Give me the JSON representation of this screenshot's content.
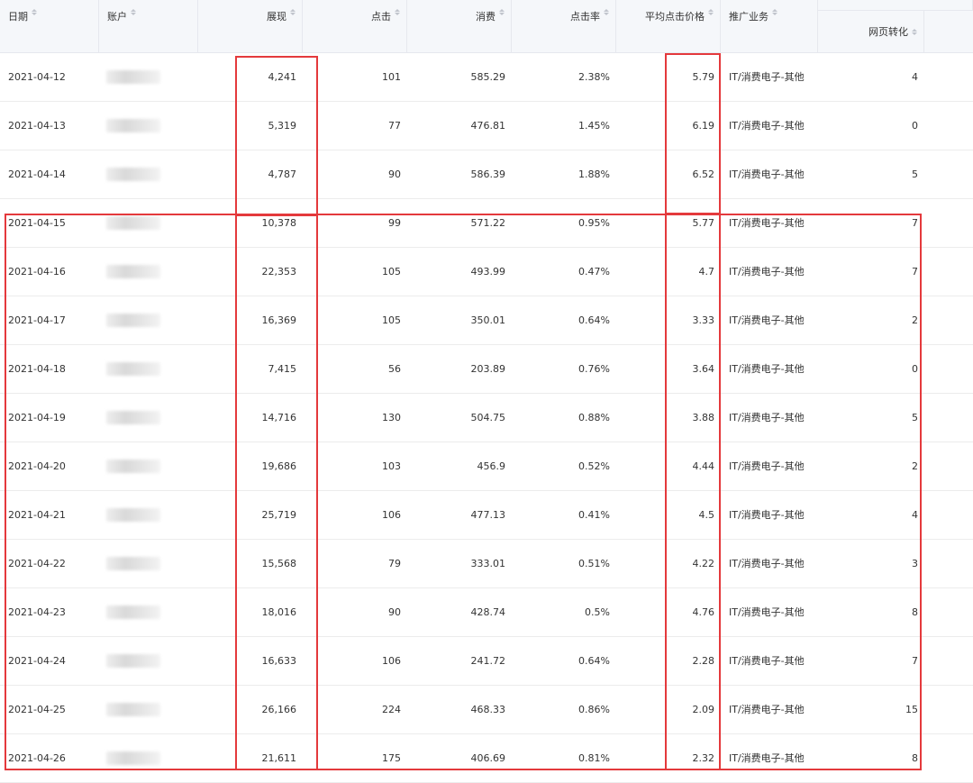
{
  "table": {
    "columns": {
      "date": "日期",
      "account": "账户",
      "impressions": "展现",
      "clicks": "点击",
      "cost": "消费",
      "ctr": "点击率",
      "avg_cpc": "平均点击价格",
      "business": "推广业务",
      "web_conversion": "网页转化"
    },
    "rows": [
      {
        "date": "2021-04-12",
        "impressions": "4,241",
        "clicks": "101",
        "cost": "585.29",
        "ctr": "2.38%",
        "avg_cpc": "5.79",
        "business": "IT/消费电子-其他",
        "web_conversion": "4"
      },
      {
        "date": "2021-04-13",
        "impressions": "5,319",
        "clicks": "77",
        "cost": "476.81",
        "ctr": "1.45%",
        "avg_cpc": "6.19",
        "business": "IT/消费电子-其他",
        "web_conversion": "0"
      },
      {
        "date": "2021-04-14",
        "impressions": "4,787",
        "clicks": "90",
        "cost": "586.39",
        "ctr": "1.88%",
        "avg_cpc": "6.52",
        "business": "IT/消费电子-其他",
        "web_conversion": "5"
      },
      {
        "date": "2021-04-15",
        "impressions": "10,378",
        "clicks": "99",
        "cost": "571.22",
        "ctr": "0.95%",
        "avg_cpc": "5.77",
        "business": "IT/消费电子-其他",
        "web_conversion": "7"
      },
      {
        "date": "2021-04-16",
        "impressions": "22,353",
        "clicks": "105",
        "cost": "493.99",
        "ctr": "0.47%",
        "avg_cpc": "4.7",
        "business": "IT/消费电子-其他",
        "web_conversion": "7"
      },
      {
        "date": "2021-04-17",
        "impressions": "16,369",
        "clicks": "105",
        "cost": "350.01",
        "ctr": "0.64%",
        "avg_cpc": "3.33",
        "business": "IT/消费电子-其他",
        "web_conversion": "2"
      },
      {
        "date": "2021-04-18",
        "impressions": "7,415",
        "clicks": "56",
        "cost": "203.89",
        "ctr": "0.76%",
        "avg_cpc": "3.64",
        "business": "IT/消费电子-其他",
        "web_conversion": "0"
      },
      {
        "date": "2021-04-19",
        "impressions": "14,716",
        "clicks": "130",
        "cost": "504.75",
        "ctr": "0.88%",
        "avg_cpc": "3.88",
        "business": "IT/消费电子-其他",
        "web_conversion": "5"
      },
      {
        "date": "2021-04-20",
        "impressions": "19,686",
        "clicks": "103",
        "cost": "456.9",
        "ctr": "0.52%",
        "avg_cpc": "4.44",
        "business": "IT/消费电子-其他",
        "web_conversion": "2"
      },
      {
        "date": "2021-04-21",
        "impressions": "25,719",
        "clicks": "106",
        "cost": "477.13",
        "ctr": "0.41%",
        "avg_cpc": "4.5",
        "business": "IT/消费电子-其他",
        "web_conversion": "4"
      },
      {
        "date": "2021-04-22",
        "impressions": "15,568",
        "clicks": "79",
        "cost": "333.01",
        "ctr": "0.51%",
        "avg_cpc": "4.22",
        "business": "IT/消费电子-其他",
        "web_conversion": "3"
      },
      {
        "date": "2021-04-23",
        "impressions": "18,016",
        "clicks": "90",
        "cost": "428.74",
        "ctr": "0.5%",
        "avg_cpc": "4.76",
        "business": "IT/消费电子-其他",
        "web_conversion": "8"
      },
      {
        "date": "2021-04-24",
        "impressions": "16,633",
        "clicks": "106",
        "cost": "241.72",
        "ctr": "0.64%",
        "avg_cpc": "2.28",
        "business": "IT/消费电子-其他",
        "web_conversion": "7"
      },
      {
        "date": "2021-04-25",
        "impressions": "26,166",
        "clicks": "224",
        "cost": "468.33",
        "ctr": "0.86%",
        "avg_cpc": "2.09",
        "business": "IT/消费电子-其他",
        "web_conversion": "15"
      },
      {
        "date": "2021-04-26",
        "impressions": "21,611",
        "clicks": "175",
        "cost": "406.69",
        "ctr": "0.81%",
        "avg_cpc": "2.32",
        "business": "IT/消费电子-其他",
        "web_conversion": "8"
      }
    ]
  },
  "colors": {
    "header_bg": "#f5f7fa",
    "highlight": "#e4393c",
    "sort_icon": "#c0c4cc"
  },
  "icons": {
    "sort": "sort-icon",
    "account_mask": "blurred-account-name"
  }
}
